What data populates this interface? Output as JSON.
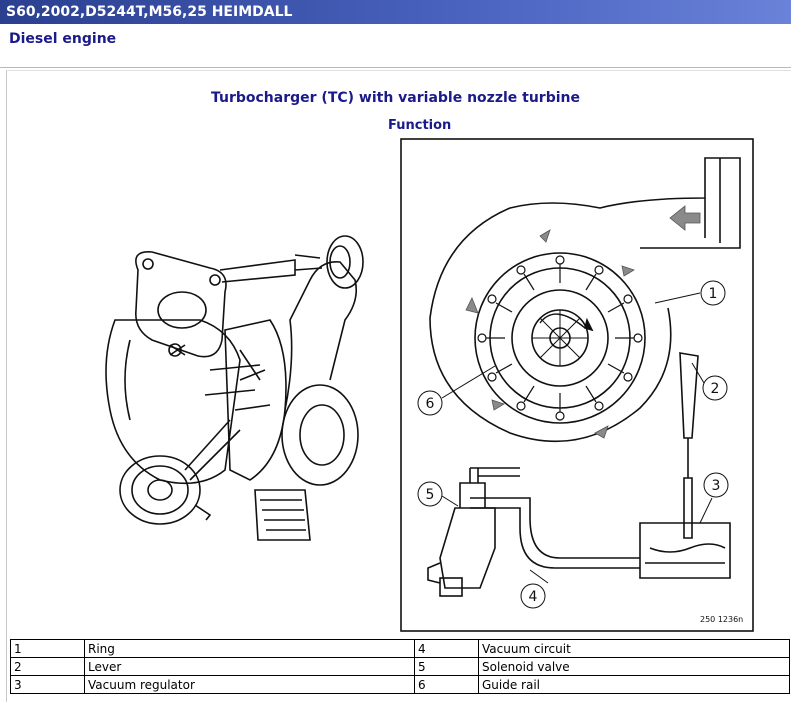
{
  "window": {
    "title": "S60,2002,D5244T,M56,25 HEIMDALL"
  },
  "header": {
    "section": "Diesel engine"
  },
  "document": {
    "title": "Turbocharger (TC) with variable nozzle turbine",
    "subtitle": "Function"
  },
  "figure": {
    "callouts": [
      "1",
      "2",
      "3",
      "4",
      "5",
      "6"
    ],
    "ref_code": "250 1236n"
  },
  "legend": {
    "rows": [
      {
        "n1": "1",
        "l1": "Ring",
        "n2": "4",
        "l2": "Vacuum circuit"
      },
      {
        "n1": "2",
        "l1": "Lever",
        "n2": "5",
        "l2": "Solenoid valve"
      },
      {
        "n1": "3",
        "l1": "Vacuum regulator",
        "n2": "6",
        "l2": "Guide rail"
      }
    ]
  }
}
